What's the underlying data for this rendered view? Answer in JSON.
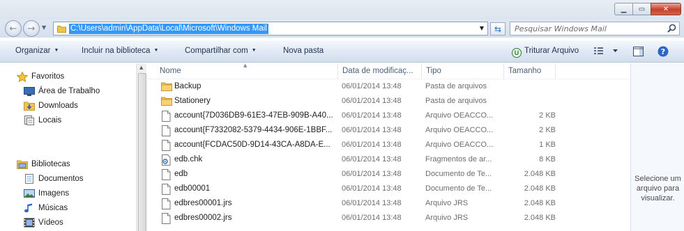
{
  "address": {
    "path": "C:\\Users\\admin\\AppData\\Local\\Microsoft\\Windows Mail"
  },
  "search": {
    "placeholder": "Pesquisar Windows Mail"
  },
  "toolbar": {
    "organize": "Organizar",
    "include_library": "Incluir na biblioteca",
    "share": "Compartilhar com",
    "new_folder": "Nova pasta",
    "shred": "Triturar Arquivo"
  },
  "nav": {
    "favorites": "Favoritos",
    "desktop": "Área de Trabalho",
    "downloads": "Downloads",
    "places": "Locais",
    "libraries": "Bibliotecas",
    "documents": "Documentos",
    "images": "Imagens",
    "music": "Músicas",
    "videos": "Vídeos"
  },
  "columns": {
    "name": "Nome",
    "date": "Data de modificaç...",
    "type": "Tipo",
    "size": "Tamanho"
  },
  "files": [
    {
      "icon": "folder-icon",
      "name": "Backup",
      "date": "06/01/2014 13:48",
      "type": "Pasta de arquivos",
      "size": ""
    },
    {
      "icon": "folder-icon",
      "name": "Stationery",
      "date": "06/01/2014 13:48",
      "type": "Pasta de arquivos",
      "size": ""
    },
    {
      "icon": "file-icon",
      "name": "account{7D036DB9-61E3-47EB-909B-A40...",
      "date": "06/01/2014 13:48",
      "type": "Arquivo OEACCO...",
      "size": "2 KB"
    },
    {
      "icon": "file-icon",
      "name": "account{F7332082-5379-4434-906E-1BBF...",
      "date": "06/01/2014 13:48",
      "type": "Arquivo OEACCO...",
      "size": "2 KB"
    },
    {
      "icon": "file-icon",
      "name": "account{FCDAC50D-9D14-43CA-A8DA-E...",
      "date": "06/01/2014 13:48",
      "type": "Arquivo OEACCO...",
      "size": "1 KB"
    },
    {
      "icon": "chk-file-icon",
      "name": "edb.chk",
      "date": "06/01/2014 13:48",
      "type": "Fragmentos de ar...",
      "size": "8 KB"
    },
    {
      "icon": "file-icon",
      "name": "edb",
      "date": "06/01/2014 13:48",
      "type": "Documento de Te...",
      "size": "2.048 KB"
    },
    {
      "icon": "file-icon",
      "name": "edb00001",
      "date": "06/01/2014 13:48",
      "type": "Documento de Te...",
      "size": "2.048 KB"
    },
    {
      "icon": "file-icon",
      "name": "edbres00001.jrs",
      "date": "06/01/2014 13:48",
      "type": "Arquivo JRS",
      "size": "2.048 KB"
    },
    {
      "icon": "file-icon",
      "name": "edbres00002.jrs",
      "date": "06/01/2014 13:48",
      "type": "Arquivo JRS",
      "size": "2.048 KB"
    }
  ],
  "preview": {
    "message": "Selecione um arquivo para visualizar."
  },
  "colors": {
    "selection": "#3399ff",
    "toolbar_text": "#1e3050",
    "close_button": "#c4412c"
  }
}
